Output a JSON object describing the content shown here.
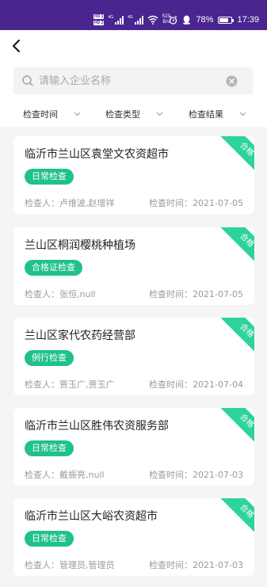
{
  "status_bar": {
    "sim1": "HD 1",
    "sim2": "HD 2",
    "signal1_tag": "4G",
    "signal2_tag": "4G",
    "speed_value": "523",
    "speed_unit": "B/s",
    "battery_percent": "78%",
    "battery_level": 0.78,
    "time": "17:39"
  },
  "nav": {
    "back_icon": "chevron-left-icon"
  },
  "search": {
    "placeholder": "请输入企业名称",
    "value": ""
  },
  "filters": [
    {
      "label": "检查时间"
    },
    {
      "label": "检查类型"
    },
    {
      "label": "检查结果"
    }
  ],
  "records": [
    {
      "name": "临沂市兰山区袁堂文农资超市",
      "type": "日常检查",
      "inspector_label": "检查人：",
      "inspectors": "卢维波,赵增祥",
      "date_label": "检查时间：",
      "date": "2021-07-05",
      "result": "合格"
    },
    {
      "name": "兰山区桐润樱桃种植场",
      "type": "合格证检查",
      "inspector_label": "检查人：",
      "inspectors": "张恒,null",
      "date_label": "检查时间：",
      "date": "2021-07-05",
      "result": "合格"
    },
    {
      "name": "兰山区家代农药经营部",
      "type": "例行检查",
      "inspector_label": "检查人：",
      "inspectors": "贾玉广,贾玉广",
      "date_label": "检查时间：",
      "date": "2021-07-04",
      "result": "合格"
    },
    {
      "name": "临沂市兰山区胜伟农资服务部",
      "type": "日常检查",
      "inspector_label": "检查人：",
      "inspectors": "戴振亮,null",
      "date_label": "检查时间：",
      "date": "2021-07-03",
      "result": "合格"
    },
    {
      "name": "临沂市兰山区大峪农资超市",
      "type": "日常检查",
      "inspector_label": "检查人：",
      "inspectors": "管理员,管理员",
      "date_label": "检查时间：",
      "date": "2021-07-03",
      "result": "合格"
    }
  ],
  "colors": {
    "status_bar": "#4a2590",
    "tag_green": "#20c18a",
    "badge_green": "#2ed39a",
    "list_background": "#f5f5f7"
  }
}
